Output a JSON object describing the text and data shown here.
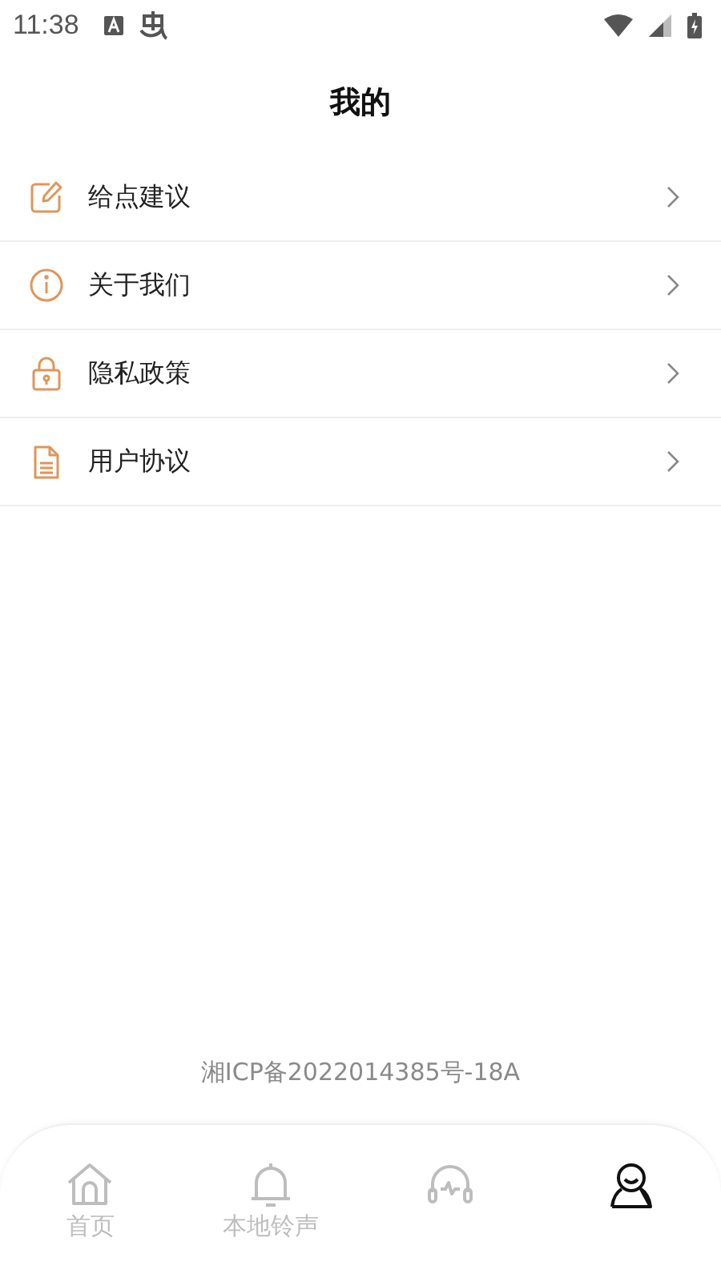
{
  "status_bar": {
    "time": "11:38"
  },
  "title": "我的",
  "menu": [
    {
      "kind": "edit",
      "label": "给点建议"
    },
    {
      "kind": "info",
      "label": "关于我们"
    },
    {
      "kind": "lock",
      "label": "隐私政策"
    },
    {
      "kind": "doc",
      "label": "用户协议"
    }
  ],
  "footer": "湘ICP备2022014385号-18A",
  "tabs": [
    {
      "kind": "home",
      "label": "首页",
      "selected": false
    },
    {
      "kind": "bell",
      "label": "本地铃声",
      "selected": false
    },
    {
      "kind": "headphones",
      "selected": false
    },
    {
      "kind": "person",
      "selected": true
    }
  ]
}
